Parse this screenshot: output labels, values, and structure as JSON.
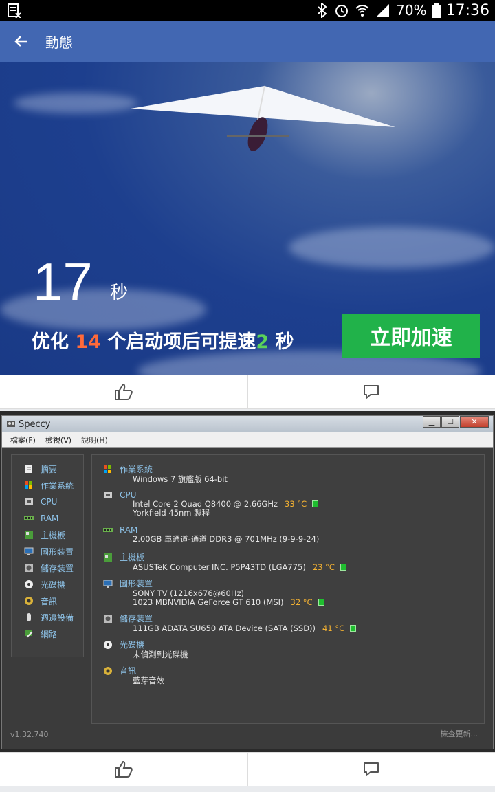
{
  "status_bar": {
    "battery_percent": "70%",
    "time": "17:36"
  },
  "app_bar": {
    "title": "動態"
  },
  "post1": {
    "big_number": "17",
    "seconds_unit": "秒",
    "optimize_prefix": "优化 ",
    "startup_count": "14",
    "optimize_middle": " 个启动项后可提速",
    "speedup_seconds": "2",
    "optimize_suffix": " 秒",
    "speed_up_button": "立即加速"
  },
  "speccy": {
    "window_title": "Speccy",
    "menu": [
      "檔案(F)",
      "檢視(V)",
      "說明(H)"
    ],
    "nav": [
      "摘要",
      "作業系統",
      "CPU",
      "RAM",
      "主機板",
      "圖形裝置",
      "儲存裝置",
      "光碟機",
      "音訊",
      "週邊設備",
      "網路"
    ],
    "sections": {
      "os": {
        "title": "作業系統",
        "line1": "Windows 7 旗艦版 64-bit"
      },
      "cpu": {
        "title": "CPU",
        "line1": "Intel Core 2 Quad Q8400 @ 2.66GHz",
        "temp": "33 °C",
        "line2": "Yorkfield 45nm 製程"
      },
      "ram": {
        "title": "RAM",
        "line1": "2.00GB 單通道-通道 DDR3 @ 701MHz (9-9-9-24)"
      },
      "mobo": {
        "title": "主機板",
        "line1": "ASUSTeK Computer INC. P5P43TD (LGA775)",
        "temp": "23 °C"
      },
      "gpu": {
        "title": "圖形裝置",
        "line1": "SONY TV (1216x676@60Hz)",
        "line2": "1023 MBNVIDIA GeForce GT 610 (MSI)",
        "temp": "32 °C"
      },
      "storage": {
        "title": "儲存裝置",
        "line1": "111GB ADATA SU650 ATA Device (SATA (SSD))",
        "temp": "41 °C"
      },
      "optical": {
        "title": "光碟機",
        "line1": "未偵測到光碟機"
      },
      "audio": {
        "title": "音訊",
        "line1": "藍芽音效"
      }
    },
    "version": "v1.32.740",
    "check_update": "檢查更新..."
  },
  "colors": {
    "facebook_blue": "#4267b2",
    "accent_green": "#21b24a",
    "speccy_link": "#8fc4ea",
    "temp_orange": "#f3b132"
  }
}
